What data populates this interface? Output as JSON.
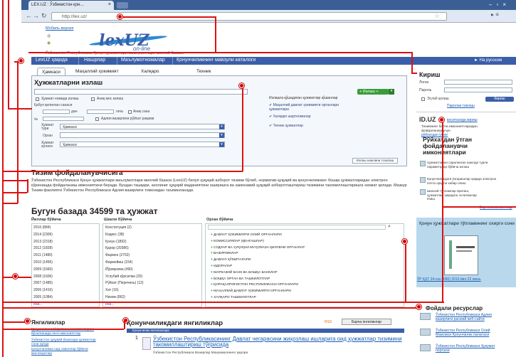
{
  "browser": {
    "tab_title": "LEX.UZ : Ўзбекистон қон...",
    "url": "http://lex.uz/",
    "back_icon": "back-arrow-icon",
    "forward_icon": "forward-arrow-icon",
    "reload_icon": "reload-icon"
  },
  "header": {
    "mobile_link": "Мобиль версия",
    "logo_lex": "lexUZ",
    "logo_online": "on-line",
    "subtitle": "Ўзбекистон Республикаси Қонун ҳужжатлари маълумотлари миллий базаси"
  },
  "main_nav": {
    "items": [
      "LexUZ ҳақида",
      "Нашрлар",
      "Маълумотномалар",
      "Қонунчиликнинг мавзули каталоги"
    ],
    "lang": "► На русском"
  },
  "search": {
    "tabs": [
      "Ҳамкаси",
      "Маҳаллий ҳокимият",
      "Халқаро",
      "Техник"
    ],
    "title": "Ҳужжатларни излаш",
    "opt_title_only": "Ҳужжат номида излаш",
    "opt_exact": "Аниқ мос келиш",
    "adoption_date": "Қабул қилинган санаси",
    "from": "дан",
    "to": "гача",
    "exact_date": "Аниқ сана",
    "number_label": "№",
    "registered": "Адлия вазирлиги рўйхат рақами",
    "type_label": "Ҳужжат тури",
    "type_value": "Ҳамкаси",
    "organ_label": "Орган",
    "status_label": "Ҳужжат ҳолати",
    "status_value": "Ҳамкаси",
    "search_button": "+ Излаш +",
    "search_in_title": "Излашга қўшадиган ҳужжатлар кўшинлар",
    "check_1": "Маҳаллий давлат ҳокимияти органлари ҳужжатлари",
    "check_2": "Халқаро шартномалар",
    "check_3": "Техник ҳужжатлар",
    "clear_button": "Излаш шаклини тозалаш"
  },
  "system": {
    "title": "Тизим фойдаланувчисига",
    "text": "Ўзбекистон Республикаси Қонун ҳужжатлари маълумотлари миллий базаси (LexUZ) белуп ҳуқуқий ахборот тизими бўлиб, норматив-ҳуқуқий ва қонунчиликнинг бошқа ҳужжатларидан электрон кўринишда фойдаланиш имкониятини беради. Бундан ташқари, ахолиниг ҳуқуқий маданиятини оширишга ва замонавий ҳуқуқий ахборотлаштириш тизимини такомиллаштиришга хизмат қилади. Мазкур Тизим фаолияти Ўзбекистон Республикаси Адлия вазирлиги томонидан таъминланади."
  },
  "database": {
    "title": "Бугун базада 34599 та ҳужжат",
    "col_years": "Йиллар бўйича",
    "col_forms": "Шакли бўйича",
    "col_organs": "Орган бўйича",
    "years": [
      "2016 (884)",
      "2014 (2306)",
      "2013 (2318)",
      "2012 (1828)",
      "2011 (1480)",
      "2010 (1456)",
      "2009 (1660)",
      "2008 (1606)",
      "2007 (1480)",
      "2006 (1410)",
      "2005 (1084)"
    ],
    "forms": [
      "Конституция (2)",
      "Кодекс (38)",
      "Қонун (1892)",
      "Қарор (20386)",
      "Фармон (2752)",
      "Фармойиш (154)",
      "Йўриқнома (490)",
      "Услубий кўрсатма (20)",
      "Рўйхат (Перечень) (12)",
      "Хат (16)",
      "Низом (862)"
    ],
    "organs": [
      "ДАВЛАТ ҲОКИМИЯТИ ОЛИЙ ОРГАНЛАРИ",
      "КОМИССИЯЛАР (ҚЕНГАШЛАР)",
      "СУДЛАР ВА ҲУҚУҚНИ МУҲОФАЗА ҚИЛУВЧИ ОРГАНЛАР",
      "ВАЗИРЛИКЛАР",
      "ДАВЛАТ ҚЎМИТАЛАРИ",
      "ИДОРАЛАР",
      "МАРКАЗИЙ БАНК ВА БОШҚА БАНКЛАР",
      "БОШҚА ОРГАН ВА ТАШКИЛОТЛАР",
      "ҚОРАҚАЛПОҒИСТОН РЕСПУБЛИКАСИ ОРГАНЛАРИ",
      "МАҲАЛЛИЙ ДАВЛАТ ҲОКИМИЯТИ ОРГАНЛАРИ",
      "ХАЛҚАРО ТАШКИЛОТЛАР"
    ],
    "more": "ёна..."
  },
  "login": {
    "title": "Кириш",
    "login_label": "Логин",
    "pass_label": "Пароль",
    "remember": "Эслаб қолиш",
    "button": "Кириш",
    "recover": "Паролни тиклаш"
  },
  "id": {
    "title": "ID.UZ",
    "link": "воситасида кириш",
    "text": "Тизимнинг барча имкониятларидан фойдаланиш учун",
    "register": "рўйхатдан ўтинг"
  },
  "registered": {
    "title": "Рўйхатдан ўтган фойдаланувчи имкониятлари",
    "items": [
      "Ҳужжатларни сараланган шаклда турли параметрлар бўйича излаш",
      "Қонунчиликдаги ўзгаришлар ҳақида электрон почта орқали хабар олиш",
      "Шахсий тўпламлар яратиш, ҳужжатлар ҳақидаги эслатмалар ёзиш"
    ],
    "more": "Барча имкониятлар"
  },
  "mobile_banner": {
    "title": "Қонун ҳужжатлари тўпламининг охирги сони",
    "code": "ЎР ҚҲТ 24-сон (680) 2016 йил 22 июнь"
  },
  "resources": {
    "title": "Фойдали ресурслар",
    "items": [
      "Ўзбекистон Республикаси Адлия вазирлиги расмий веб-сайти",
      "Ўзбекистон Республикаси Олий Мажлиси Қонунчилик палатаси",
      "Ўзбекистон Республикаси Ҳукумат портали"
    ]
  },
  "news": {
    "title": "Янгиликлар",
    "items": [
      "Қонунчилик ахборотини шакллантириш йўналишида янги имкониятлар",
      "Ўзбекистон ҳуқуқий базасида ҳужжатлар сони ортди",
      "Қонунчиликка оид саволлар бўйича маслаҳатлар"
    ]
  },
  "legislation": {
    "title": "Қонунчиликдаги янгиликлар",
    "bar": "Қонунчилик янгиликлари",
    "rss": "RSS",
    "all": "Барча янгиликлар",
    "item_num": "1",
    "item_title": "Ўзбекистон Республикасининг Давлат чегарасини жиҳозлаш ишларига оид ҳужжатлар тизимини такомиллаштириш тўғрисида",
    "item_date": "Ўзбекистон Республикаси Вазирлар Маҳкамасининг қарори"
  },
  "colors": {
    "accent": "#3a5ea8",
    "callout": "#dd1111",
    "green": "#3a9d3a"
  }
}
